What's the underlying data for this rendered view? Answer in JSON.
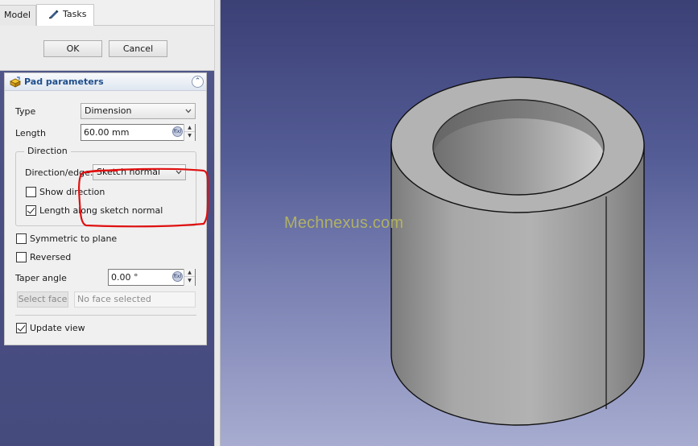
{
  "tabs": [
    {
      "label": "Model"
    },
    {
      "label": "Tasks"
    }
  ],
  "dialog_buttons": {
    "ok": "OK",
    "cancel": "Cancel"
  },
  "pad": {
    "title": "Pad parameters",
    "type_label": "Type",
    "type_value": "Dimension",
    "length_label": "Length",
    "length_value": "60.00 mm",
    "direction": {
      "title": "Direction",
      "edge_label": "Direction/edge:",
      "edge_value": "Sketch normal",
      "show_direction": {
        "label": "Show direction",
        "checked": false
      },
      "along_normal": {
        "label": "Length along sketch normal",
        "checked": true
      }
    },
    "symmetric": {
      "label": "Symmetric to plane",
      "checked": false
    },
    "reversed": {
      "label": "Reversed",
      "checked": false
    },
    "taper_label": "Taper angle",
    "taper_value": "0.00 °",
    "select_face_label": "Select face",
    "face_placeholder": "No face selected",
    "update_view": {
      "label": "Update view",
      "checked": true
    }
  },
  "viewport": {
    "watermark": "Mechnexus.com",
    "highlight_color": "#e01010"
  },
  "icons": [
    "pen-icon",
    "pad-icon",
    "collapse-icon",
    "dropdown-arrow-icon",
    "expression-icon",
    "spin-arrows-icon"
  ]
}
